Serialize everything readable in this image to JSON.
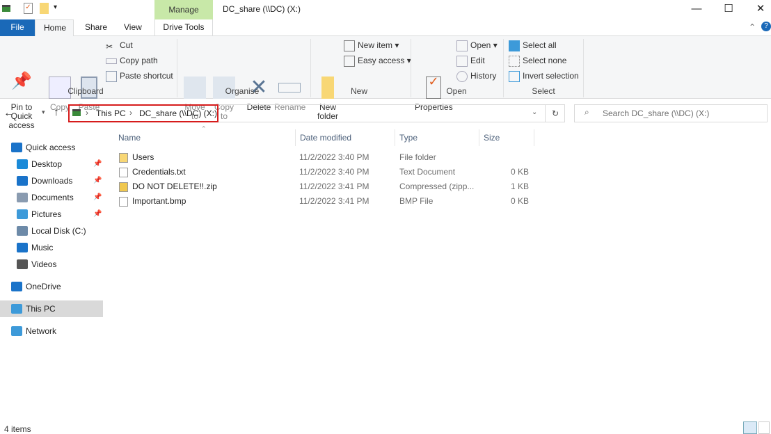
{
  "window": {
    "title": "DC_share (\\\\DC) (X:)",
    "context_tab": "Manage",
    "minimize": "—",
    "maximize": "☐",
    "close": "✕"
  },
  "tabs": [
    {
      "label": "File"
    },
    {
      "label": "Home"
    },
    {
      "label": "Share"
    },
    {
      "label": "View"
    },
    {
      "label": "Drive Tools"
    }
  ],
  "ribbon": {
    "clipboard": {
      "group": "Clipboard",
      "pin": "Pin to Quick access",
      "copy": "Copy",
      "paste": "Paste",
      "cut": "Cut",
      "copy_path": "Copy path",
      "paste_shortcut": "Paste shortcut"
    },
    "organise": {
      "group": "Organise",
      "move_to": "Move to",
      "copy_to": "Copy to",
      "delete": "Delete",
      "rename": "Rename"
    },
    "new": {
      "group": "New",
      "new_folder": "New folder",
      "new_item": "New item",
      "easy_access": "Easy access"
    },
    "open": {
      "group": "Open",
      "properties": "Properties",
      "open": "Open",
      "edit": "Edit",
      "history": "History"
    },
    "select": {
      "group": "Select",
      "select_all": "Select all",
      "select_none": "Select none",
      "invert": "Invert selection"
    }
  },
  "address": {
    "crumbs": [
      "This PC",
      "DC_share (\\\\DC) (X:)"
    ],
    "search_placeholder": "Search DC_share (\\\\DC) (X:)"
  },
  "sidebar": [
    {
      "label": "Quick access",
      "icon": "star-icon",
      "color": "#1a73c9"
    },
    {
      "label": "Desktop",
      "icon": "desktop-icon",
      "pinned": true,
      "color": "#1a8ad8"
    },
    {
      "label": "Downloads",
      "icon": "download-icon",
      "pinned": true,
      "color": "#1a73c9"
    },
    {
      "label": "Documents",
      "icon": "document-icon",
      "pinned": true,
      "color": "#8a9bb0"
    },
    {
      "label": "Pictures",
      "icon": "pictures-icon",
      "pinned": true,
      "color": "#3d9ad9"
    },
    {
      "label": "Local Disk (C:)",
      "icon": "disk-icon",
      "color": "#6d8aa8"
    },
    {
      "label": "Music",
      "icon": "music-icon",
      "color": "#1a73c9"
    },
    {
      "label": "Videos",
      "icon": "video-icon",
      "color": "#555"
    },
    {
      "label": "OneDrive",
      "icon": "cloud-icon",
      "color": "#1a73c9"
    },
    {
      "label": "This PC",
      "icon": "computer-icon",
      "selected": true,
      "color": "#3d9ad9"
    },
    {
      "label": "Network",
      "icon": "network-icon",
      "color": "#3d9ad9"
    }
  ],
  "columns": [
    "Name",
    "Date modified",
    "Type",
    "Size"
  ],
  "files": [
    {
      "name": "Users",
      "date": "11/2/2022 3:40 PM",
      "type": "File folder",
      "size": "",
      "icon": "folder-icon"
    },
    {
      "name": "Credentials.txt",
      "date": "11/2/2022 3:40 PM",
      "type": "Text Document",
      "size": "0 KB",
      "icon": "text-file-icon"
    },
    {
      "name": "DO NOT DELETE!!.zip",
      "date": "11/2/2022 3:41 PM",
      "type": "Compressed (zipp...",
      "size": "1 KB",
      "icon": "zip-icon"
    },
    {
      "name": "Important.bmp",
      "date": "11/2/2022 3:41 PM",
      "type": "BMP File",
      "size": "0 KB",
      "icon": "image-file-icon"
    }
  ],
  "status": {
    "count": "4 items"
  }
}
